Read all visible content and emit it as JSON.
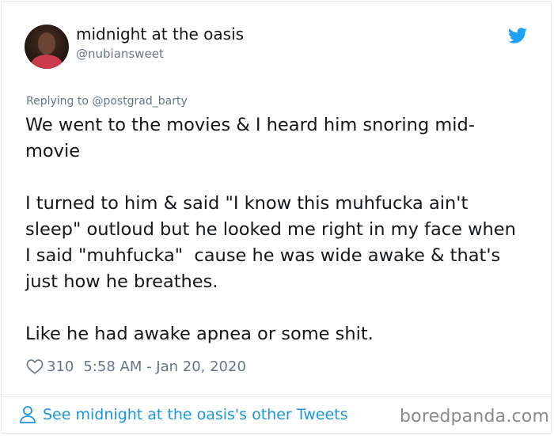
{
  "author": {
    "display_name": "midnight at the oasis",
    "handle": "@nubiansweet"
  },
  "reply": {
    "prefix": "Replying to",
    "mention": "@postgrad_barty"
  },
  "tweet": {
    "text": "We went to the movies & I heard him snoring mid-movie\n\nI turned to him & said \"I know this muhfucka ain't sleep\" outloud but he looked me right in my face when I said \"muhfucka\"  cause he was wide awake & that's just how he breathes.\n\nLike he had awake apnea or some shit."
  },
  "meta": {
    "likes": "310",
    "timestamp": "5:58 AM - Jan 20, 2020"
  },
  "footer": {
    "link_text": "See midnight at the oasis's other Tweets"
  },
  "watermark": "boredpanda.com",
  "colors": {
    "twitter_blue": "#1da1f2",
    "link_blue": "#1b95e0",
    "secondary_text": "#657786",
    "primary_text": "#14171a"
  },
  "icons": [
    "twitter-bird-icon",
    "heart-icon",
    "person-icon"
  ]
}
